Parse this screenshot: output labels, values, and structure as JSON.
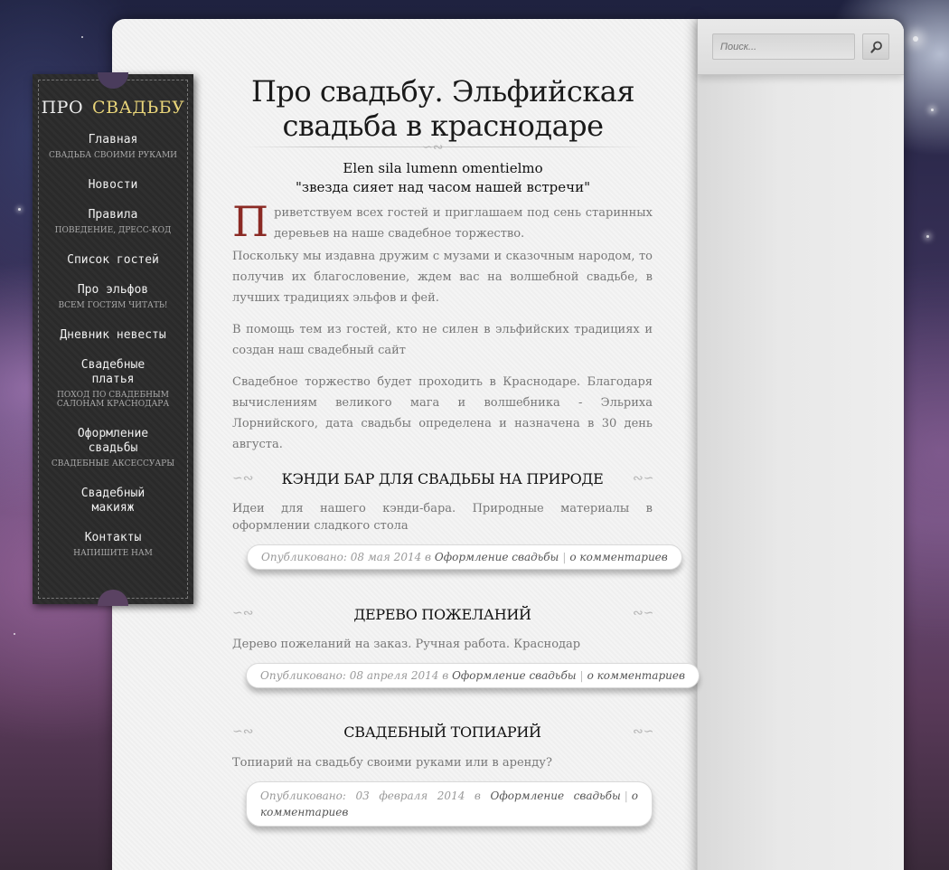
{
  "site": {
    "logo_part1": "ПРО",
    "logo_part2": "СВАДЬБУ"
  },
  "nav": {
    "items": [
      {
        "label": "Главная",
        "sub": "Свадьба своими руками"
      },
      {
        "label": "Новости",
        "sub": ""
      },
      {
        "label": "Правила",
        "sub": "Поведение, дресс-код"
      },
      {
        "label": "Список гостей",
        "sub": ""
      },
      {
        "label": "Про эльфов",
        "sub": "Всем гостям читать!"
      },
      {
        "label": "Дневник невесты",
        "sub": ""
      },
      {
        "label": "Свадебные платья",
        "sub": "Поход по свадебным салонам Краснодара"
      },
      {
        "label": "Оформление свадьбы",
        "sub": "Свадебные аксессуары"
      },
      {
        "label": "Свадебный макияж",
        "sub": ""
      },
      {
        "label": "Контакты",
        "sub": "Напишите нам"
      }
    ]
  },
  "search": {
    "placeholder": "Поиск..."
  },
  "article": {
    "title": "Про свадьбу. Эльфийская свадьба в краснодаре",
    "subtitle_line1": "Elen sila lumenn omentielmo",
    "subtitle_line2": "\"звезда сияет над часом нашей встречи\"",
    "dropcap": "П",
    "p1": "риветствуем всех гостей и приглашаем под сень старинных деревьев на наше свадебное торжество.",
    "p2": "Поскольку мы издавна дружим с музами и сказочным народом, то получив их благословение, ждем вас  на волшебной свадьбе, в лучших традициях эльфов и фей.",
    "p3": "В помощь тем из гостей, кто не силен в эльфийских традициях и создан наш свадебный сайт",
    "p4": "Свадебное торжество будет проходить в Краснодаре. Благодаря вычислениям великого мага и волшебника - Эльриха Лорнийского, дата свадьбы определена и назначена в 30 день августа."
  },
  "posts": [
    {
      "title": "Кэнди бар для свадьбы на природе",
      "excerpt": "Идеи для нашего кэнди-бара. Природные материалы в оформлении сладкого стола",
      "published_prefix": "Опубликовано: 08 мая 2014 в",
      "category": "Оформление свадьбы",
      "comments": "о комментариев"
    },
    {
      "title": "Дерево пожеланий",
      "excerpt": "Дерево пожеланий на заказ. Ручная работа. Краснодар",
      "published_prefix": "Опубликовано: 08 апреля 2014 в",
      "category": "Оформление свадьбы",
      "comments": "о комментариев"
    },
    {
      "title": "Свадебный топиарий",
      "excerpt": "Топиарий на свадьбу своими руками или в аренду?",
      "published_prefix": "Опубликовано: 03 февраля 2014 в",
      "category": "Оформление свадьбы",
      "comments": "о комментариев"
    }
  ],
  "icons": {
    "search": "search-icon",
    "ornament": "swirl-ornament-icon"
  },
  "colors": {
    "logo_accent": "#e8d479",
    "dropcap": "#8b2a24",
    "nav_bg": "#2a2a2a"
  }
}
